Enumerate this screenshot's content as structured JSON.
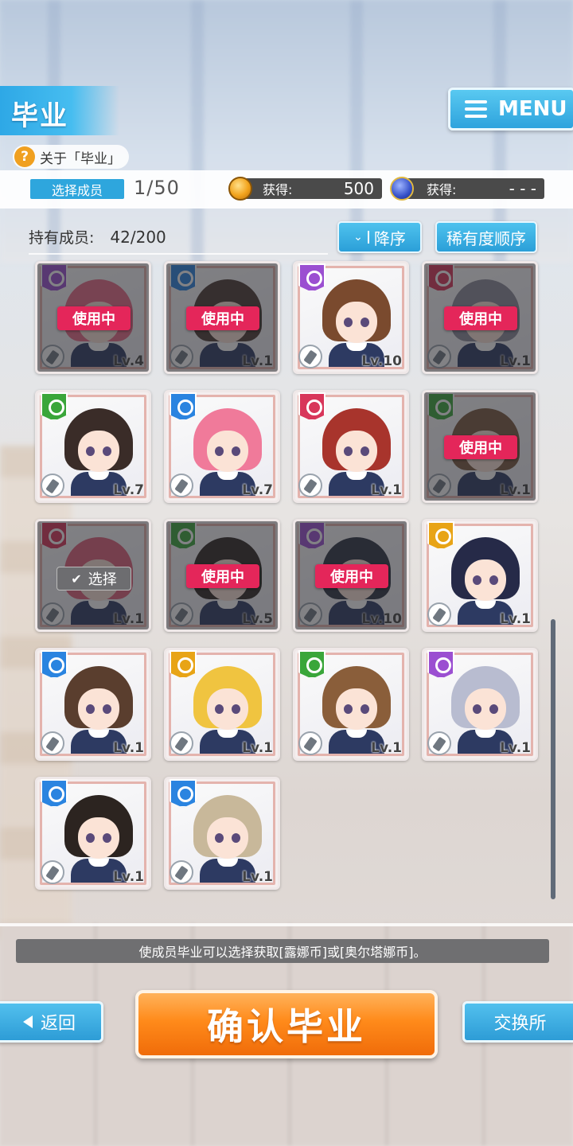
{
  "header": {
    "title": "毕业",
    "about_label": "关于「毕业」",
    "about_icon": "question-icon",
    "menu_label": "MENU"
  },
  "selection": {
    "label": "选择成员",
    "count": "1/50"
  },
  "rewards": {
    "gold": {
      "icon": "gold-coin-icon",
      "label": "获得:",
      "value": "500"
    },
    "star": {
      "icon": "star-coin-icon",
      "label": "获得:",
      "value": "- - -"
    }
  },
  "owned": {
    "label": "持有成员:",
    "count": "42/200"
  },
  "sort": {
    "order_label": "降序",
    "rarity_label": "稀有度顺序"
  },
  "members": [
    {
      "level": "Lv.4",
      "status": "使用中",
      "badge_color": "#9b4fd1",
      "hair": "#e86a86"
    },
    {
      "level": "Lv.1",
      "status": "使用中",
      "badge_color": "#2a84e0",
      "hair": "#4a3a32"
    },
    {
      "level": "Lv.10",
      "status": "",
      "badge_color": "#9b4fd1",
      "hair": "#7a4a2e"
    },
    {
      "level": "Lv.1",
      "status": "使用中",
      "badge_color": "#d8365a",
      "hair": "#8a8a98"
    },
    {
      "level": "Lv.7",
      "status": "",
      "badge_color": "#3aa63a",
      "hair": "#3a2c28"
    },
    {
      "level": "Lv.7",
      "status": "",
      "badge_color": "#2a84e0",
      "hair": "#f07a9a"
    },
    {
      "level": "Lv.1",
      "status": "",
      "badge_color": "#d8365a",
      "hair": "#a8342c"
    },
    {
      "level": "Lv.1",
      "status": "使用中",
      "badge_color": "#3aa63a",
      "hair": "#7a5a3e"
    },
    {
      "level": "Lv.1",
      "status": "选择",
      "badge_color": "#d8365a",
      "hair": "#e0607a"
    },
    {
      "level": "Lv.5",
      "status": "使用中",
      "badge_color": "#3aa63a",
      "hair": "#2e2622"
    },
    {
      "level": "Lv.10",
      "status": "使用中",
      "badge_color": "#9b4fd1",
      "hair": "#2c3240"
    },
    {
      "level": "Lv.1",
      "status": "",
      "badge_color": "#e8a416",
      "hair": "#262a48"
    },
    {
      "level": "Lv.1",
      "status": "",
      "badge_color": "#2a84e0",
      "hair": "#5a3e2e"
    },
    {
      "level": "Lv.1",
      "status": "",
      "badge_color": "#e8a416",
      "hair": "#f0c440"
    },
    {
      "level": "Lv.1",
      "status": "",
      "badge_color": "#3aa63a",
      "hair": "#8a5e3a"
    },
    {
      "level": "Lv.1",
      "status": "",
      "badge_color": "#9b4fd1",
      "hair": "#b8bcd0"
    },
    {
      "level": "Lv.1",
      "status": "",
      "badge_color": "#2a84e0",
      "hair": "#2c2420"
    },
    {
      "level": "Lv.1",
      "status": "",
      "badge_color": "#2a84e0",
      "hair": "#c8b89a"
    }
  ],
  "footer": {
    "notice": "使成员毕业可以选择获取[露娜币]或[奥尔塔娜币]。",
    "back_label": "返回",
    "confirm_label": "确认毕业",
    "exchange_label": "交换所"
  }
}
